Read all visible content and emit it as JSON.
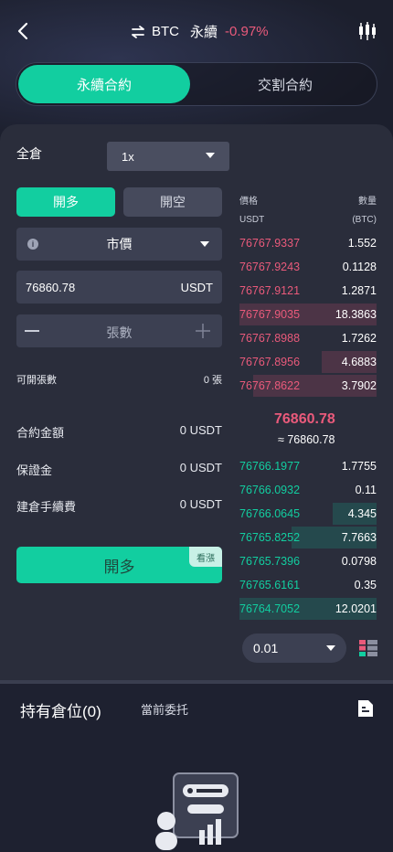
{
  "header": {
    "symbol": "BTC",
    "contract_type": "永續",
    "change": "-0.97%",
    "icons": {
      "back": "back-arrow-icon",
      "swap": "swap-arrows-icon",
      "chart": "candlestick-chart-icon"
    }
  },
  "contract_tabs": {
    "active": "永續合約",
    "inactive": "交割合約"
  },
  "order_form": {
    "margin_mode": "全倉",
    "leverage": "1x",
    "side_long": "開多",
    "side_short": "開空",
    "order_type": "市價",
    "price_value": "76860.78",
    "price_unit": "USDT",
    "qty_placeholder": "張數",
    "openable_label": "可開張數",
    "openable_value": "0 張",
    "contract_amount_label": "合約金額",
    "contract_amount_value": "0 USDT",
    "margin_label": "保證金",
    "margin_value": "0 USDT",
    "fee_label": "建倉手續費",
    "fee_value": "0 USDT",
    "submit_label": "開多",
    "submit_badge": "看漲"
  },
  "order_book": {
    "price_header": "價格",
    "amount_header": "數量",
    "price_unit": "USDT",
    "amount_unit": "(BTC)",
    "asks": [
      {
        "price": "76767.9337",
        "amount": "1.552",
        "depth": 0.0
      },
      {
        "price": "76767.9243",
        "amount": "0.1128",
        "depth": 0.0
      },
      {
        "price": "76767.9121",
        "amount": "1.2871",
        "depth": 0.0
      },
      {
        "price": "76767.9035",
        "amount": "18.3863",
        "depth": 1.0
      },
      {
        "price": "76767.8988",
        "amount": "1.7262",
        "depth": 0.0
      },
      {
        "price": "76767.8956",
        "amount": "4.6883",
        "depth": 0.4
      },
      {
        "price": "76767.8622",
        "amount": "3.7902",
        "depth": 0.9
      }
    ],
    "mid_price": "76860.78",
    "mid_approx": "≈ 76860.78",
    "bids": [
      {
        "price": "76766.1977",
        "amount": "1.7755",
        "depth": 0.0
      },
      {
        "price": "76766.0932",
        "amount": "0.11",
        "depth": 0.0
      },
      {
        "price": "76766.0645",
        "amount": "4.345",
        "depth": 0.32
      },
      {
        "price": "76765.8252",
        "amount": "7.7663",
        "depth": 0.62
      },
      {
        "price": "76765.7396",
        "amount": "0.0798",
        "depth": 0.0
      },
      {
        "price": "76765.6161",
        "amount": "0.35",
        "depth": 0.0
      },
      {
        "price": "76764.7052",
        "amount": "12.0201",
        "depth": 1.0
      }
    ],
    "precision": "0.01",
    "colors": {
      "ask": "#ea5a7b",
      "bid": "#12cea0"
    }
  },
  "positions": {
    "holdings_tab": "持有倉位(0)",
    "orders_tab": "當前委托"
  },
  "theme": {
    "accent": "#12cea0",
    "panel": "#2a2d3b",
    "background": "#1e2130"
  }
}
